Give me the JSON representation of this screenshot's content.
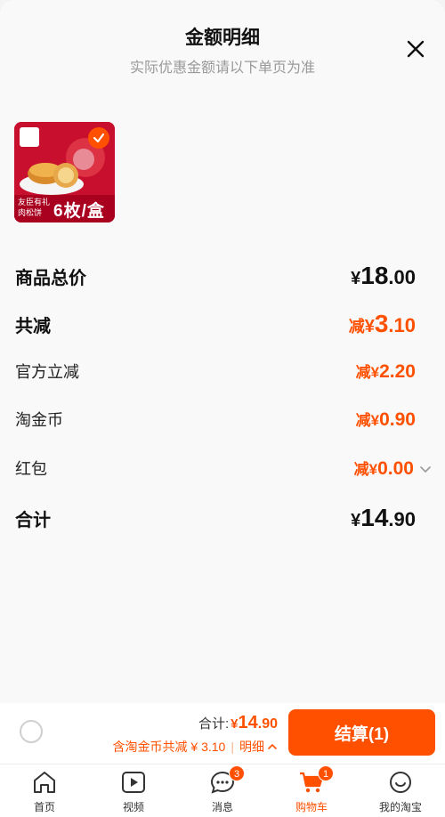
{
  "header": {
    "title": "金额明细",
    "subtitle": "实际优惠金额请以下单页为准"
  },
  "product": {
    "selected": true,
    "image_text_small": "友臣有礼\n肉松饼",
    "image_text_big": "6枚/盒"
  },
  "rows": [
    {
      "label": "商品总价",
      "prefix": "",
      "currency": "¥",
      "int": "18",
      "dec": ".00",
      "color": "black",
      "bold": false
    },
    {
      "label": "共减",
      "prefix": "减",
      "currency": "¥",
      "int": "3",
      "dec": ".10",
      "color": "orange",
      "bold": true
    },
    {
      "label": "官方立减",
      "prefix": "减",
      "currency": "¥",
      "int": "2",
      "dec": ".20",
      "color": "orange",
      "bold": false
    },
    {
      "label": "淘金币",
      "prefix": "减",
      "currency": "¥",
      "int": "0",
      "dec": ".90",
      "color": "orange",
      "bold": false
    },
    {
      "label": "红包",
      "prefix": "减",
      "currency": "¥",
      "int": "0",
      "dec": ".00",
      "color": "orange",
      "bold": false
    },
    {
      "label": "合计",
      "prefix": "",
      "currency": "¥",
      "int": "14",
      "dec": ".90",
      "color": "black",
      "bold": true
    }
  ],
  "footer": {
    "total_label": "合计:",
    "total_currency": "¥",
    "total_int": "14",
    "total_dec": ".90",
    "discount_text": "含淘金币共减 ¥ 3.10",
    "separator": "|",
    "detail_label": "明细",
    "checkout_label": "结算(1)"
  },
  "tabs": [
    {
      "label": "首页",
      "icon": "home-icon",
      "badge": ""
    },
    {
      "label": "视频",
      "icon": "video-icon",
      "badge": ""
    },
    {
      "label": "消息",
      "icon": "message-icon",
      "badge": "3"
    },
    {
      "label": "购物车",
      "icon": "cart-icon",
      "badge": "1",
      "active": true
    },
    {
      "label": "我的淘宝",
      "icon": "profile-icon",
      "badge": ""
    }
  ],
  "colors": {
    "accent": "#ff5000",
    "text": "#111111",
    "muted": "#999999"
  }
}
